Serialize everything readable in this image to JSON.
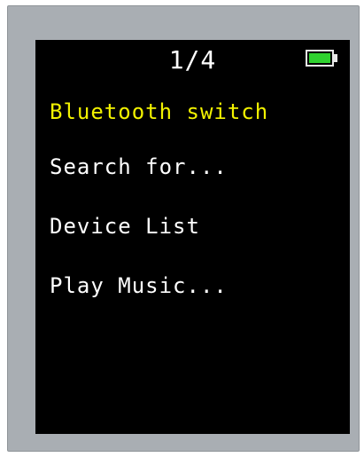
{
  "status_bar": {
    "page_indicator": "1/4",
    "battery_icon": "battery-full-icon",
    "battery_level": 1.0
  },
  "menu": {
    "items": [
      {
        "label": "Bluetooth switch",
        "selected": true
      },
      {
        "label": "Search for...",
        "selected": false
      },
      {
        "label": "Device List",
        "selected": false
      },
      {
        "label": "Play Music...",
        "selected": false
      }
    ]
  },
  "colors": {
    "selected_text": "#f2f200",
    "normal_text": "#ffffff",
    "screen_background": "#000000",
    "battery_fill": "#2fd22f",
    "bezel": "#a9aeb3"
  }
}
